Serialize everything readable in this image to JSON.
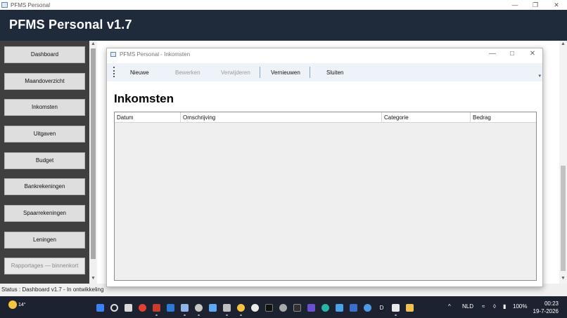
{
  "window": {
    "title": "PFMS Personal",
    "icon": "app-window-icon",
    "controls": [
      "minimize",
      "maximize",
      "close"
    ]
  },
  "header": {
    "title": "PFMS Personal v1.7"
  },
  "sidebar": {
    "items": [
      {
        "label": "Dashboard",
        "enabled": true
      },
      {
        "label": "Maandoverzicht",
        "enabled": true
      },
      {
        "label": "Inkomsten",
        "enabled": true
      },
      {
        "label": "Uitgaven",
        "enabled": true
      },
      {
        "label": "Budget",
        "enabled": true
      },
      {
        "label": "Bankrekeningen",
        "enabled": true
      },
      {
        "label": "Spaarrekeningen",
        "enabled": true
      },
      {
        "label": "Leningen",
        "enabled": true
      },
      {
        "label": "Rapportages — binnenkort",
        "enabled": false
      }
    ]
  },
  "status": {
    "text": "Status : Dashboard v1.7 - In ontwikkeling"
  },
  "child_window": {
    "title": "PFMS Personal - Inkomsten",
    "toolbar": {
      "buttons": [
        {
          "label": "Nieuwe",
          "enabled": true
        },
        {
          "label": "Bewerken",
          "enabled": false
        },
        {
          "label": "Verwijderen",
          "enabled": false
        },
        {
          "label": "Vernieuwen",
          "enabled": true
        },
        {
          "label": "Sluiten",
          "enabled": true
        }
      ]
    },
    "heading": "Inkomsten",
    "table": {
      "columns": [
        "Datum",
        "Omschrijving",
        "Categorie",
        "Bedrag"
      ],
      "rows": []
    }
  },
  "taskbar": {
    "weather": "14°",
    "tray": {
      "language": "NLD",
      "battery": "100%"
    },
    "clock": {
      "time": "00:23",
      "date": "19-7-2026"
    }
  },
  "colors": {
    "header_bg": "#1f2b3a",
    "sidebar_bg": "#3f3f3f",
    "taskbar_bg": "#1c2230",
    "toolbar_bg": "#eef3f9"
  }
}
